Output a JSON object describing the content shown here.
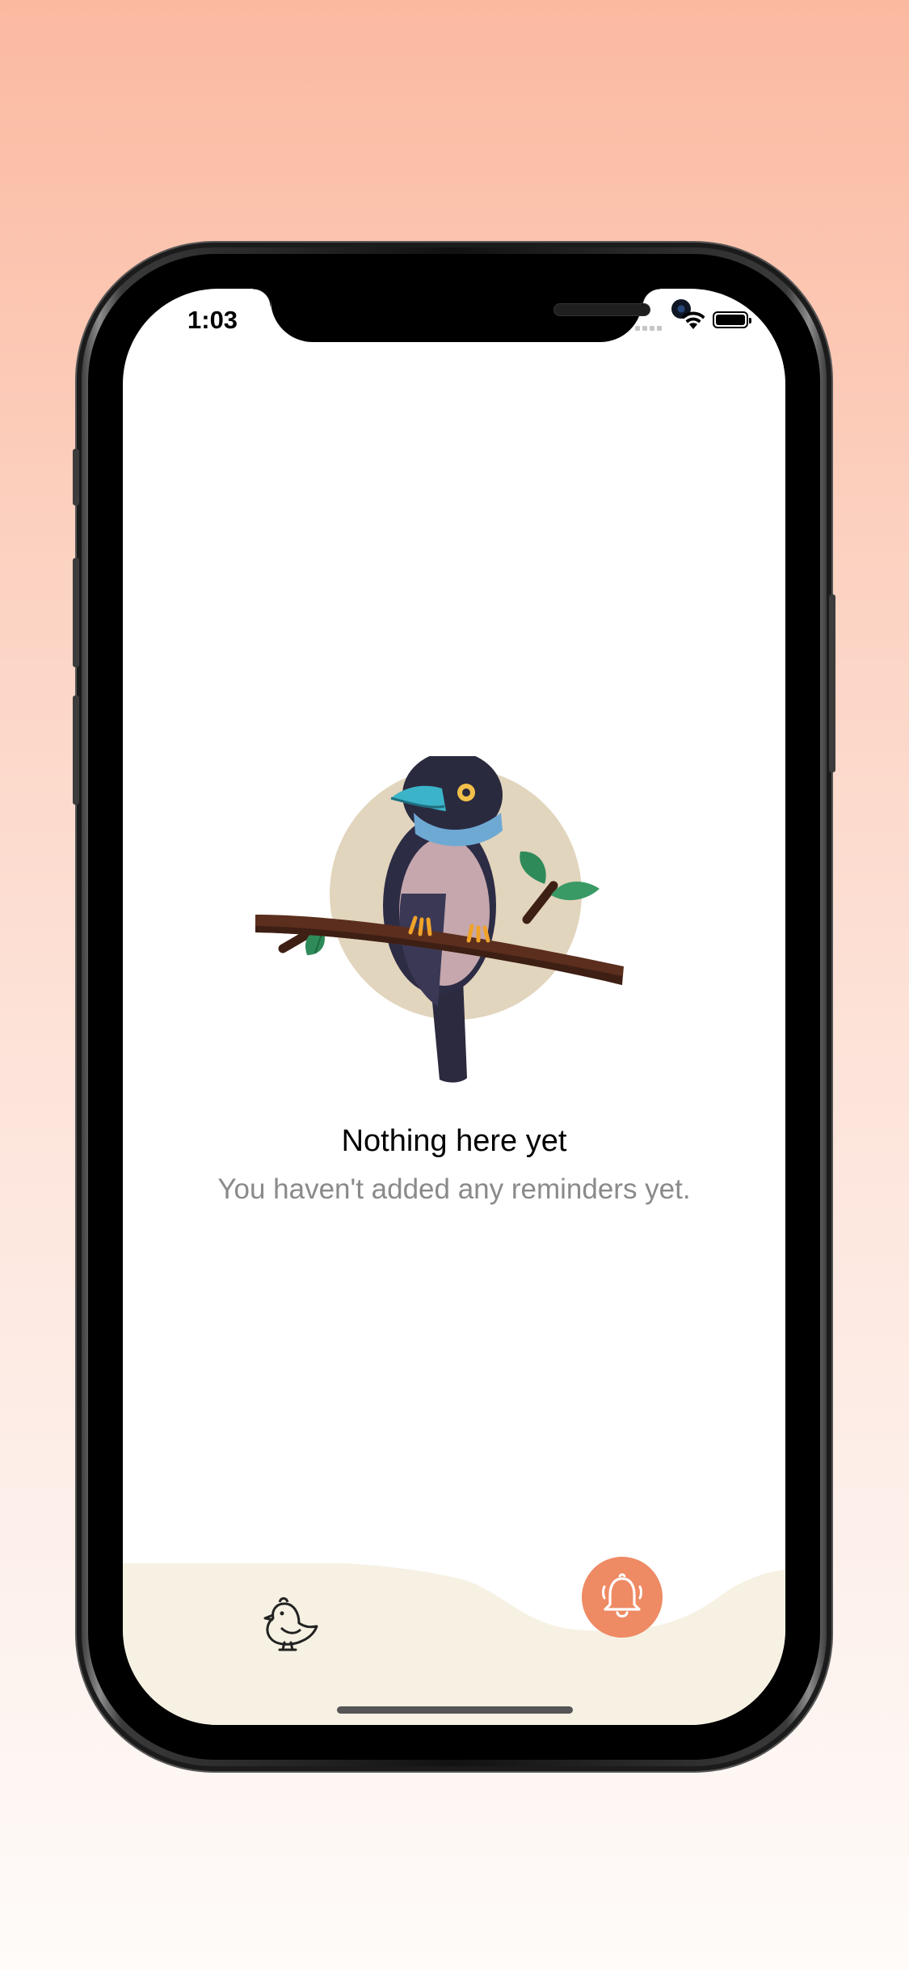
{
  "status_bar": {
    "time": "1:03"
  },
  "empty_state": {
    "title": "Nothing here yet",
    "subtitle": "You haven't added any reminders yet."
  },
  "tab_bar": {
    "items": [
      {
        "icon": "bird-icon"
      },
      {
        "icon": "bell-icon",
        "active": true
      }
    ]
  },
  "colors": {
    "accent": "#ee8a64",
    "tabbar_bg": "#f6f1e3",
    "subtitle_text": "#8a8a8a"
  }
}
